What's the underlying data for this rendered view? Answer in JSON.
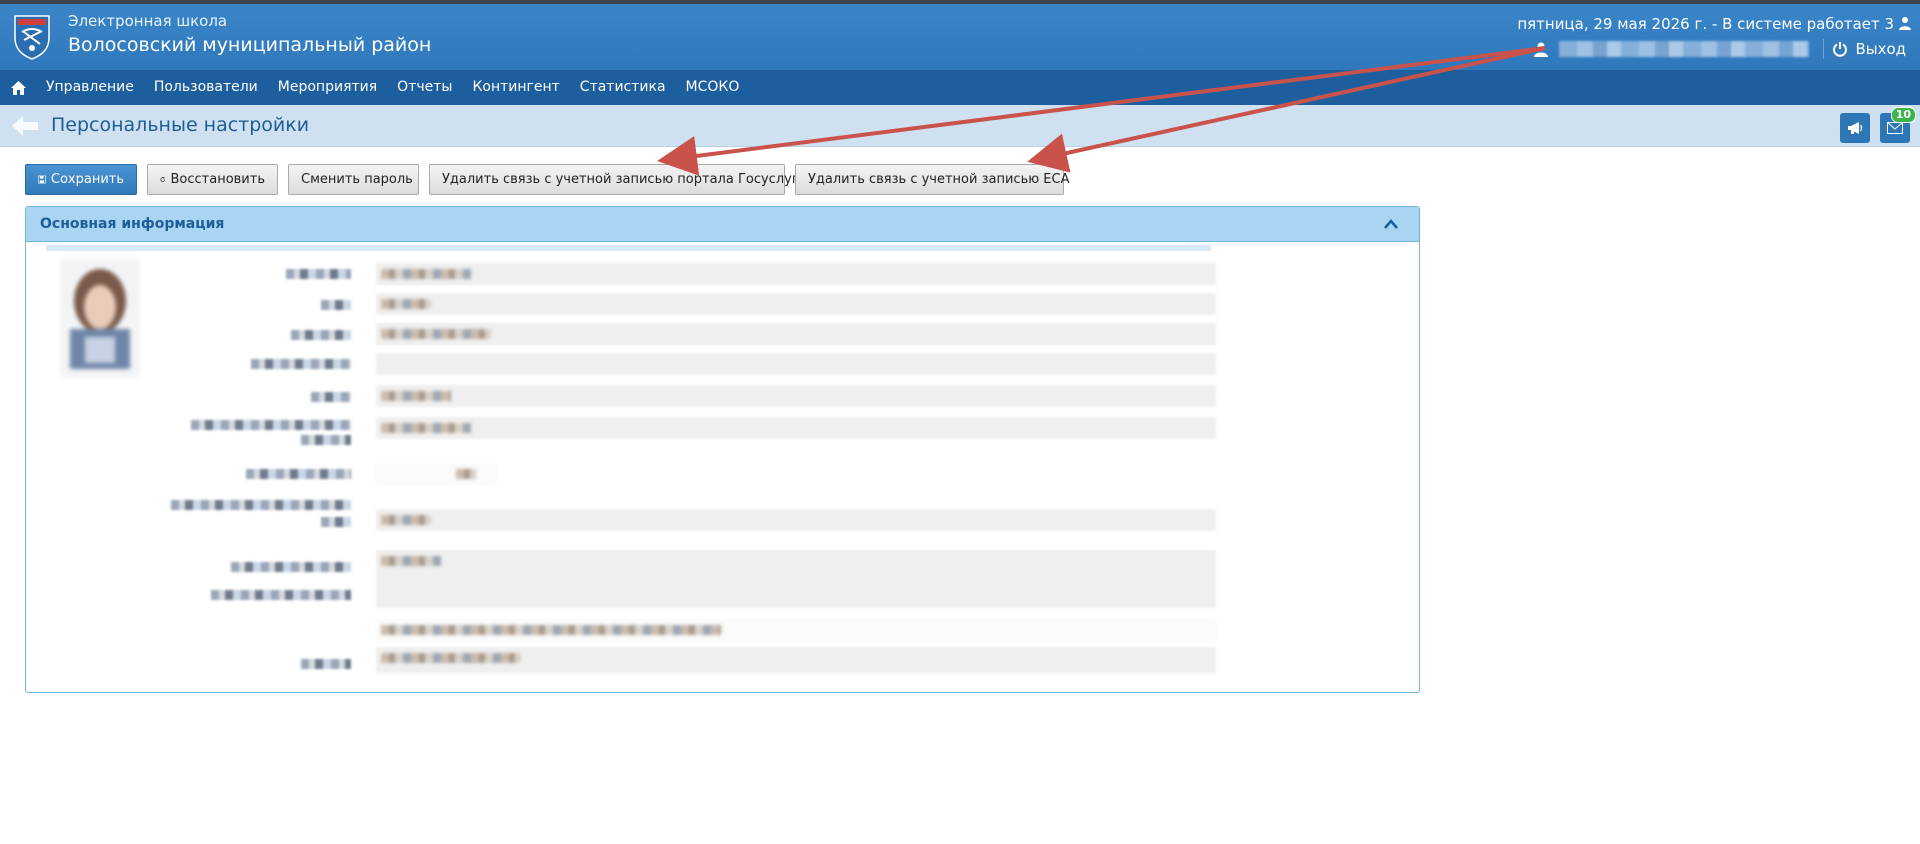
{
  "header": {
    "app_name": "Электронная школа",
    "district": "Волосовский муниципальный район",
    "status": "пятница, 29 мая 2026 г. - В системе работает 3",
    "logout_label": "Выход"
  },
  "nav": {
    "items": [
      {
        "label": "Управление"
      },
      {
        "label": "Пользователи"
      },
      {
        "label": "Мероприятия"
      },
      {
        "label": "Отчеты"
      },
      {
        "label": "Контингент"
      },
      {
        "label": "Статистика"
      },
      {
        "label": "МСОКО"
      }
    ]
  },
  "page": {
    "title": "Персональные настройки",
    "notifications_badge": "10"
  },
  "toolbar": {
    "save_label": "Сохранить",
    "restore_label": "Восстановить",
    "change_password_label": "Сменить пароль",
    "unlink_gosuslugi_label": "Удалить связь с учетной записью портала Госуслуг",
    "unlink_esa_label": "Удалить связь с учетной записью ЕСА"
  },
  "panel": {
    "title": "Основная информация"
  },
  "colors": {
    "header": "#2f78bb",
    "nav": "#1d5f9e",
    "titlebar": "#cfe1f1",
    "panel_head": "#a9d5f2",
    "arrow": "#c9524a",
    "badge": "#3cb44a"
  },
  "icons": [
    "home-icon",
    "back-arrow-icon",
    "user-icon",
    "power-icon",
    "megaphone-icon",
    "envelope-icon",
    "save-icon",
    "refresh-icon",
    "chevron-up-icon",
    "coat-of-arms-logo"
  ]
}
